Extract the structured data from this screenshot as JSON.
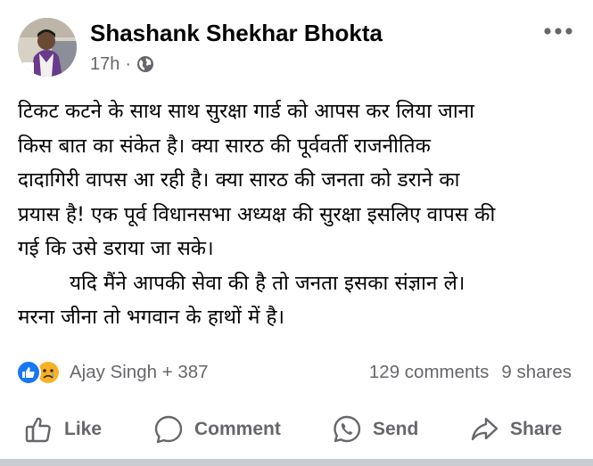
{
  "post": {
    "author": "Shashank Shekhar Bhokta",
    "time": "17h",
    "separator": "·",
    "privacy_icon": "globe-icon",
    "more_icon": "more-horizontal-icon",
    "text_lines": [
      "टिकट कटने के साथ साथ सुरक्षा गार्ड को आपस कर लिया जाना",
      "किस बात का संकेत है। क्या सारठ की पूर्ववर्ती राजनीतिक",
      "दादागिरी वापस आ रही है। क्या सारठ की जनता को डराने का",
      "प्रयास है! एक पूर्व विधानसभा अध्यक्ष की सुरक्षा इसलिए वापस की",
      "गई कि उसे डराया जा सके।",
      "यदि मैंने आपकी सेवा की है तो जनता इसका संज्ञान ले।",
      "मरना जीना तो भगवान के हाथों में है।"
    ]
  },
  "reactions": {
    "icons": [
      "like-reaction-icon",
      "sad-reaction-icon"
    ],
    "summary": "Ajay Singh + 387",
    "comments": "129 comments",
    "shares": "9 shares"
  },
  "actions": {
    "like": "Like",
    "comment": "Comment",
    "send": "Send",
    "share": "Share"
  },
  "colors": {
    "primary_text": "#050505",
    "secondary_text": "#65676b",
    "like_blue": "#1877f2",
    "sad_yellow": "#f7b125"
  }
}
